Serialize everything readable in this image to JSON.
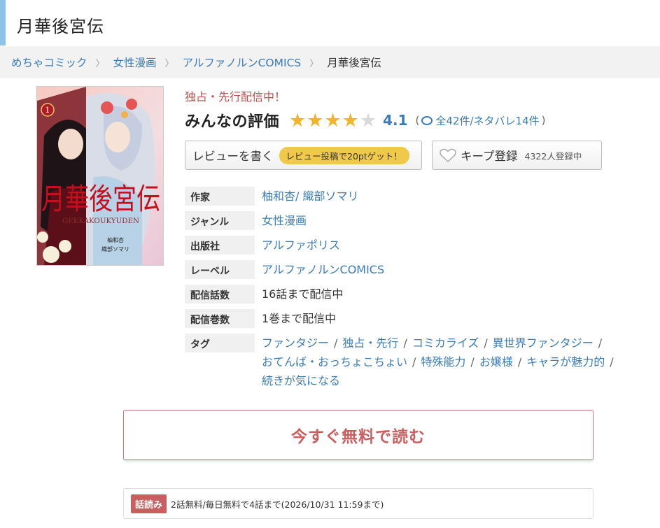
{
  "title": "月華後宮伝",
  "breadcrumb": [
    {
      "label": "めちゃコミック"
    },
    {
      "label": "女性漫画"
    },
    {
      "label": "アルファノルンCOMICS"
    }
  ],
  "breadcrumb_current": "月華後宮伝",
  "cover": {
    "volume_number": "1",
    "title_text": "月華後宮伝",
    "romaji": "GEKKAKOUKYUDEN",
    "author_text": "柚和杏",
    "artist_text": "織部ソマリ"
  },
  "exclusive_label": "独占・先行配信中！",
  "rating": {
    "label": "みんなの評価",
    "stars_filled": 4,
    "stars_total": 5,
    "score": "4.1",
    "counts": "全42件/ネタバレ14件"
  },
  "buttons": {
    "review_label": "レビューを書く",
    "review_promo": "レビュー投稿で20ptゲット！",
    "keep_label": "キープ登録",
    "keep_count": "4322人登録中"
  },
  "info": {
    "author_label": "作家",
    "author_value": "柚和杏/ 織部ソマリ",
    "genre_label": "ジャンル",
    "genre_value": "女性漫画",
    "publisher_label": "出版社",
    "publisher_value": "アルファポリス",
    "label_label": "レーベル",
    "label_value": "アルファノルンCOMICS",
    "episodes_label": "配信話数",
    "episodes_value": "16話まで配信中",
    "volumes_label": "配信巻数",
    "volumes_value": "1巻まで配信中",
    "tags_label": "タグ",
    "tags": [
      "ファンタジー",
      "独占・先行",
      "コミカライズ",
      "異世界ファンタジー",
      "おてんば・おっちょこちょい",
      "特殊能力",
      "お嬢様",
      "キャラが魅力的",
      "続きが気になる"
    ]
  },
  "read_button": "今すぐ無料で読む",
  "free_info": {
    "badge": "話読み",
    "text": "2話無料/毎日無料で4話まで(2026/10/31 11:59まで)"
  },
  "colors": {
    "accent_blue": "#3b7cb8",
    "accent_red": "#c9605f",
    "star": "#f2b42c",
    "title_bar": "#8cc3e6"
  }
}
